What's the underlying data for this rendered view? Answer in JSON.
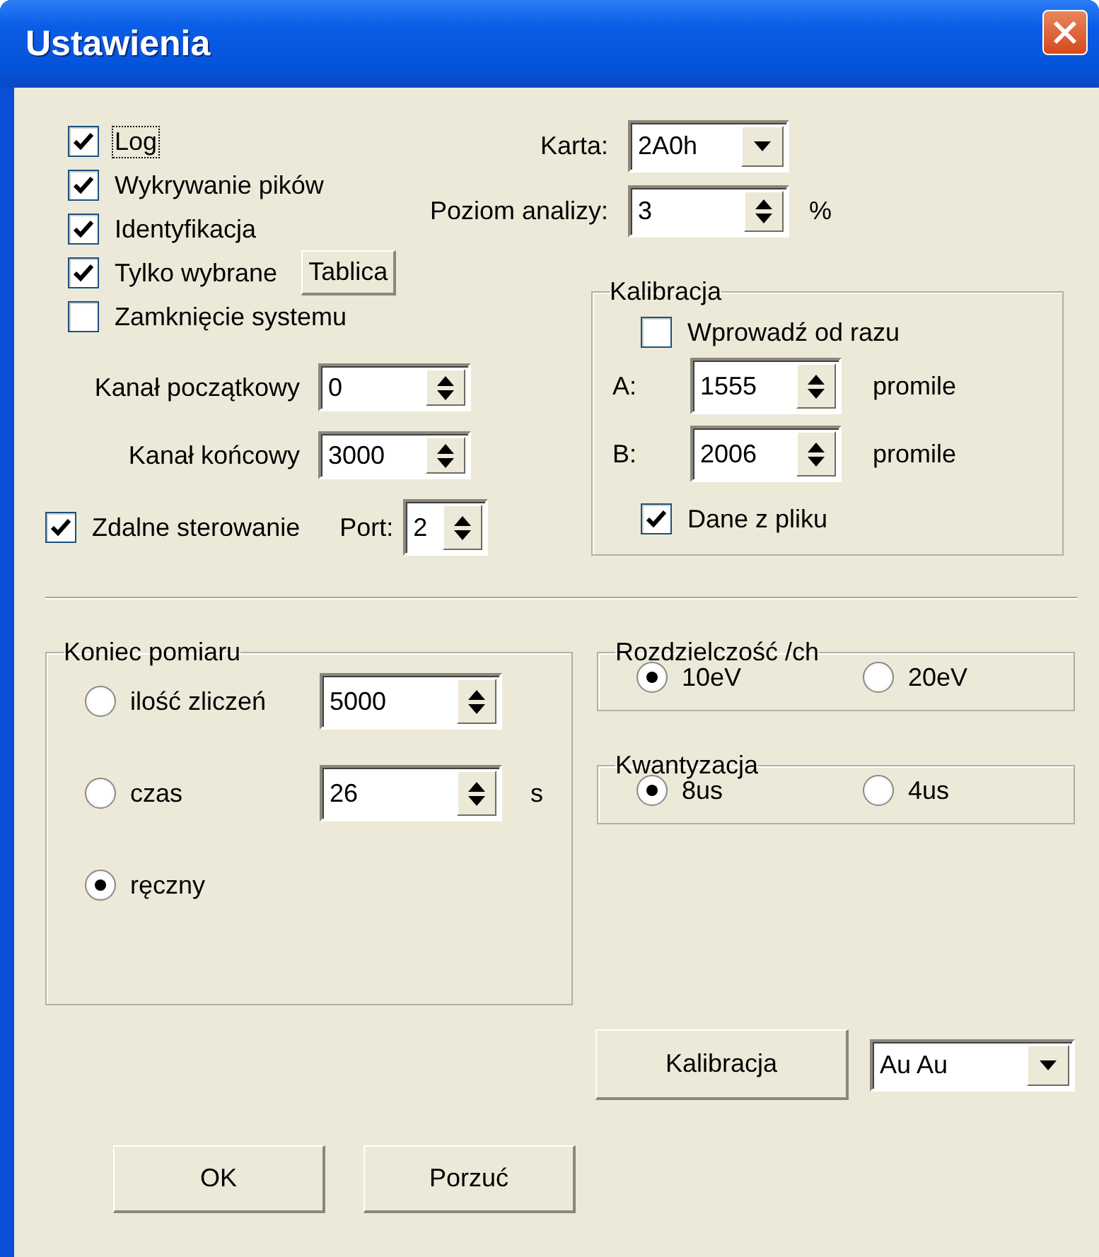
{
  "window": {
    "title": "Ustawienia"
  },
  "options": [
    {
      "label": "Log",
      "checked": true,
      "focused": true
    },
    {
      "label": "Wykrywanie pików",
      "checked": true,
      "focused": false
    },
    {
      "label": "Identyfikacja",
      "checked": true,
      "focused": false
    },
    {
      "label": "Tylko wybrane",
      "checked": true,
      "focused": false,
      "button": "Tablica"
    },
    {
      "label": "Zamknięcie systemu",
      "checked": false,
      "focused": false
    }
  ],
  "card": {
    "label": "Karta:",
    "value": "2A0h"
  },
  "analysis_level": {
    "label": "Poziom analizy:",
    "value": "3",
    "unit": "%"
  },
  "start_channel": {
    "label": "Kanał początkowy",
    "value": "0"
  },
  "end_channel": {
    "label": "Kanał końcowy",
    "value": "3000"
  },
  "remote_control": {
    "label": "Zdalne sterowanie",
    "checked": true
  },
  "port": {
    "label": "Port:",
    "value": "2"
  },
  "calibration": {
    "title": "Kalibracja",
    "enter_now": {
      "label": "Wprowadź od razu",
      "checked": false
    },
    "a": {
      "label": "A:",
      "value": "1555",
      "unit": "promile"
    },
    "b": {
      "label": "B:",
      "value": "2006",
      "unit": "promile"
    },
    "from_file": {
      "label": "Dane z pliku",
      "checked": true
    }
  },
  "measurement_end": {
    "title": "Koniec pomiaru",
    "options": [
      {
        "label": "ilość zliczeń",
        "selected": false,
        "value": "5000"
      },
      {
        "label": "czas",
        "selected": false,
        "value": "26",
        "unit": "s"
      },
      {
        "label": "ręczny",
        "selected": true
      }
    ]
  },
  "resolution": {
    "title": "Rozdzielczość /ch",
    "options": [
      {
        "label": "10eV",
        "selected": true
      },
      {
        "label": "20eV",
        "selected": false
      }
    ]
  },
  "quantization": {
    "title": "Kwantyzacja",
    "options": [
      {
        "label": "8us",
        "selected": true
      },
      {
        "label": "4us",
        "selected": false
      }
    ]
  },
  "calibrate_button": "Kalibracja",
  "element_select": {
    "value": "Au Au"
  },
  "buttons": [
    "OK",
    "Porzuć"
  ]
}
